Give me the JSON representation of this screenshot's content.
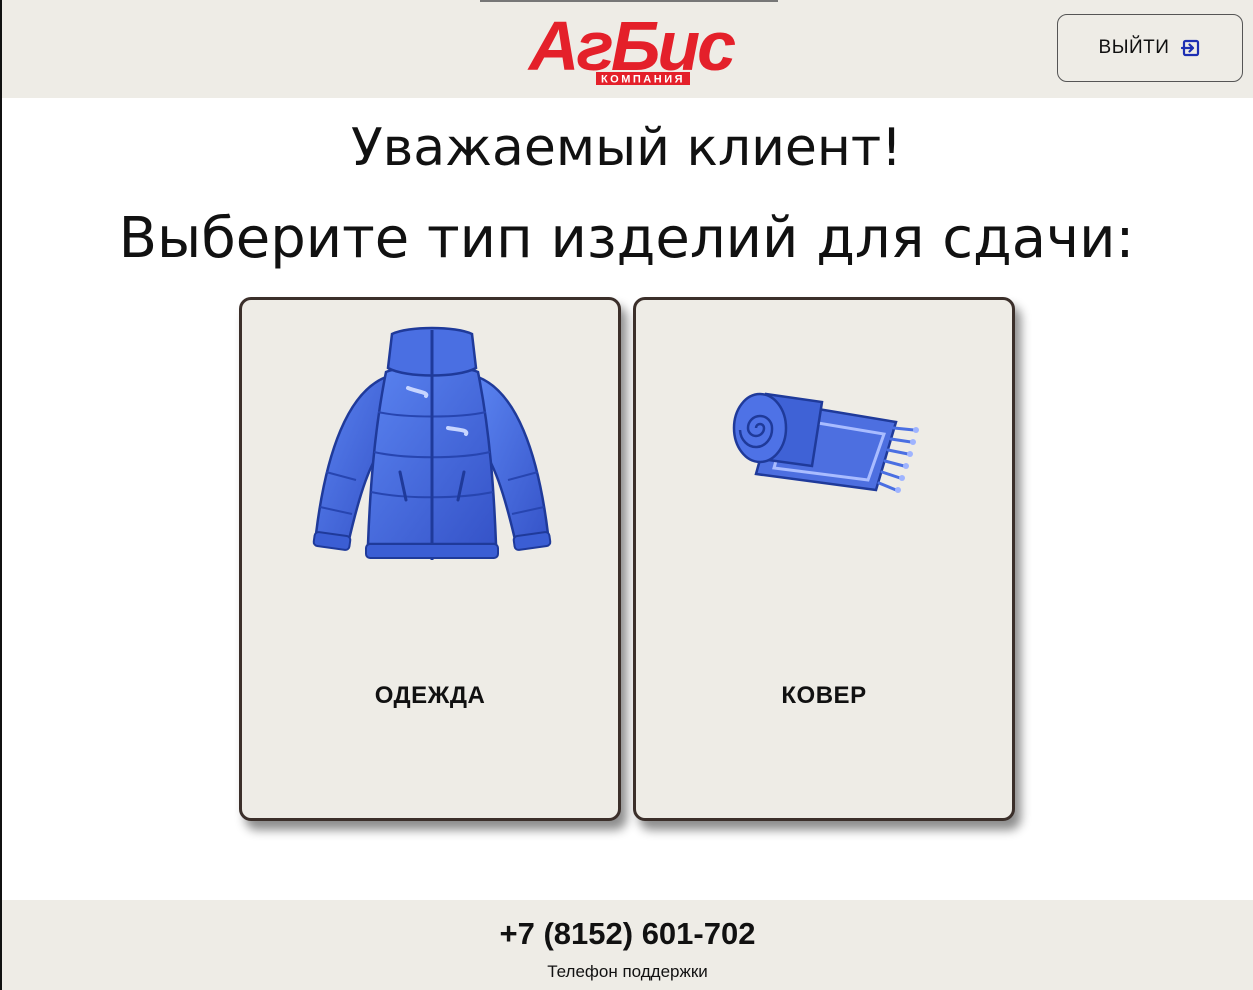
{
  "header": {
    "logo_brand": "АгБис",
    "logo_sub": "КОМПАНИЯ",
    "logout_label": "ВЫЙТИ",
    "logout_icon": "logout-icon"
  },
  "main": {
    "greeting": "Уважаемый клиент!",
    "prompt": "Выберите тип изделий для сдачи:",
    "cards": [
      {
        "label": "ОДЕЖДА",
        "icon": "jacket-icon"
      },
      {
        "label": "КОВЕР",
        "icon": "carpet-icon"
      }
    ]
  },
  "footer": {
    "phone": "+7 (8152) 601-702",
    "caption": "Телефон поддержки"
  },
  "colors": {
    "brand_red": "#e4202a",
    "panel_bg": "#eeece6",
    "card_border": "#3b2f2a",
    "item_blue": "#3f63d8"
  }
}
